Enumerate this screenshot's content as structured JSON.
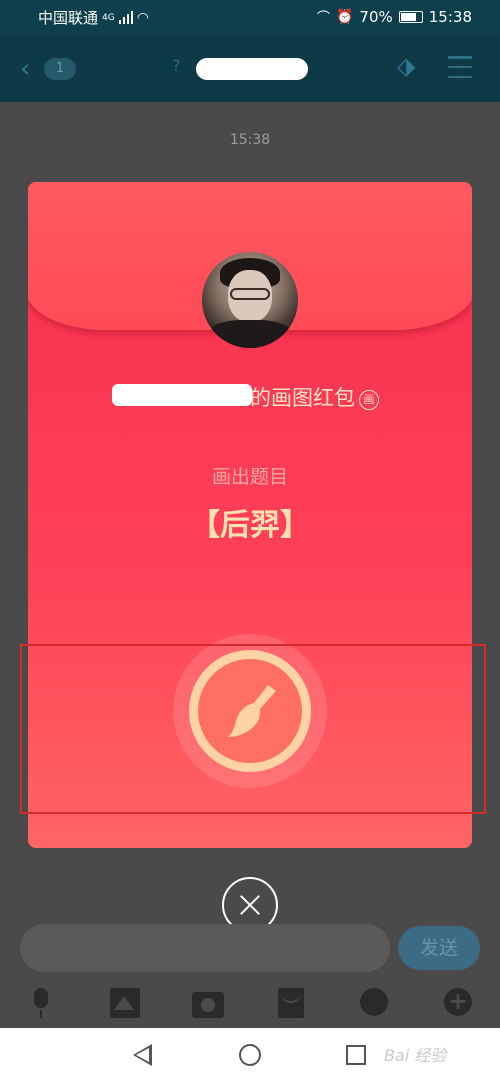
{
  "status_bar": {
    "carrier": "中国联通",
    "network": "4G",
    "battery": "70%",
    "time": "15:38"
  },
  "chat_header": {
    "unread_count": "1"
  },
  "chat": {
    "timestamp": "15:38"
  },
  "red_packet": {
    "sender_suffix": "的画图红包",
    "type_badge": "画",
    "prompt_label": "画出题目",
    "prompt_word": "【后羿】"
  },
  "input_bar": {
    "send_label": "发送"
  },
  "watermark": "Bai 经验",
  "icons": {
    "back": "chevron-left-icon",
    "tag": "tag-icon",
    "menu": "hamburger-icon",
    "brush": "paint-brush-icon",
    "close": "close-icon",
    "mic": "microphone-icon",
    "image": "image-icon",
    "camera": "camera-icon",
    "packet": "red-packet-icon",
    "emoji": "emoji-icon",
    "plus": "plus-icon"
  },
  "colors": {
    "packet_red": "#ff4257",
    "packet_gold": "#ffd3a6",
    "highlight_border": "#d62b2b"
  }
}
